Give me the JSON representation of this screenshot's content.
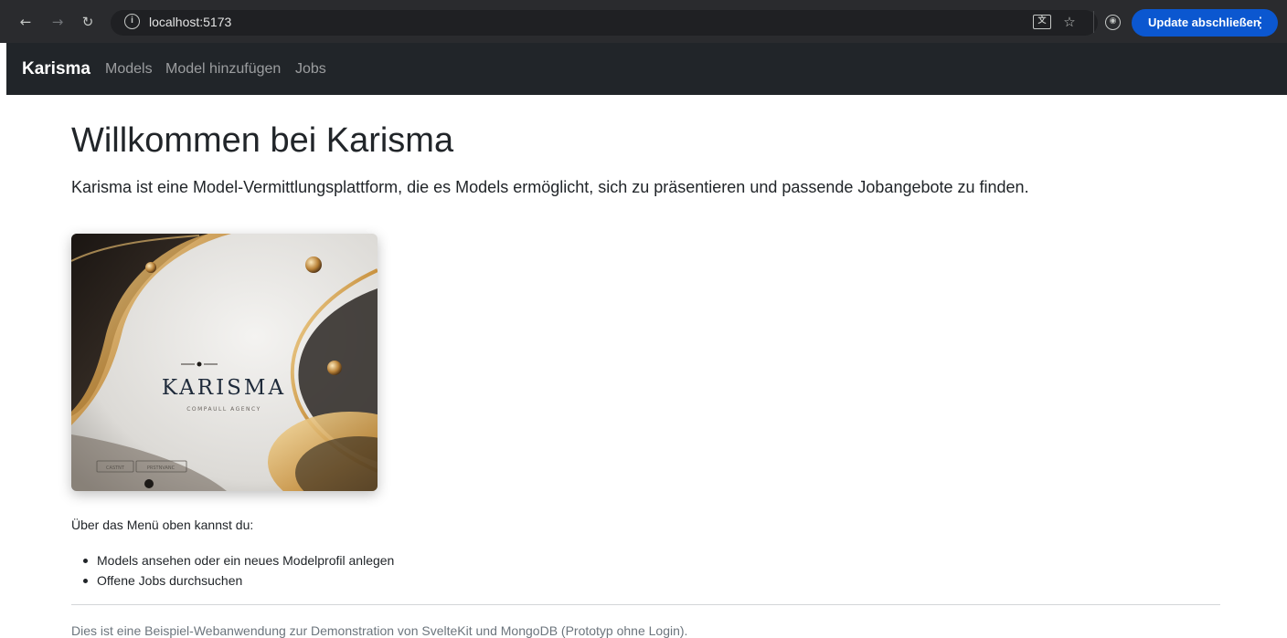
{
  "browser": {
    "back_icon": "arrow-left",
    "forward_icon": "arrow-right",
    "reload_icon": "reload",
    "site_info_icon": "info-circle",
    "url": "localhost:5173",
    "update_button": "Update abschließen",
    "accent_color": "#0b57d0"
  },
  "navbar": {
    "brand": "Karisma",
    "links": [
      "Models",
      "Model hinzufügen",
      "Jobs"
    ]
  },
  "main": {
    "title": "Willkommen bei Karisma",
    "lead": "Karisma ist eine Model-Vermittlungsplattform, die es Models ermöglicht, sich zu präsentieren und passende Jobangebote zu finden.",
    "hero_image": {
      "logo_text": "KARISMA",
      "tagline": "COMPAULL AGENCY",
      "button_a": "CASTNT",
      "button_b": "PRSTNVANC"
    },
    "intro": "Über das Menü oben kannst du:",
    "features": [
      "Models ansehen oder ein neues Modelprofil anlegen",
      "Offene Jobs durchsuchen"
    ],
    "footer_note": "Dies ist eine Beispiel-Webanwendung zur Demonstration von SvelteKit und MongoDB (Prototyp ohne Login)."
  }
}
